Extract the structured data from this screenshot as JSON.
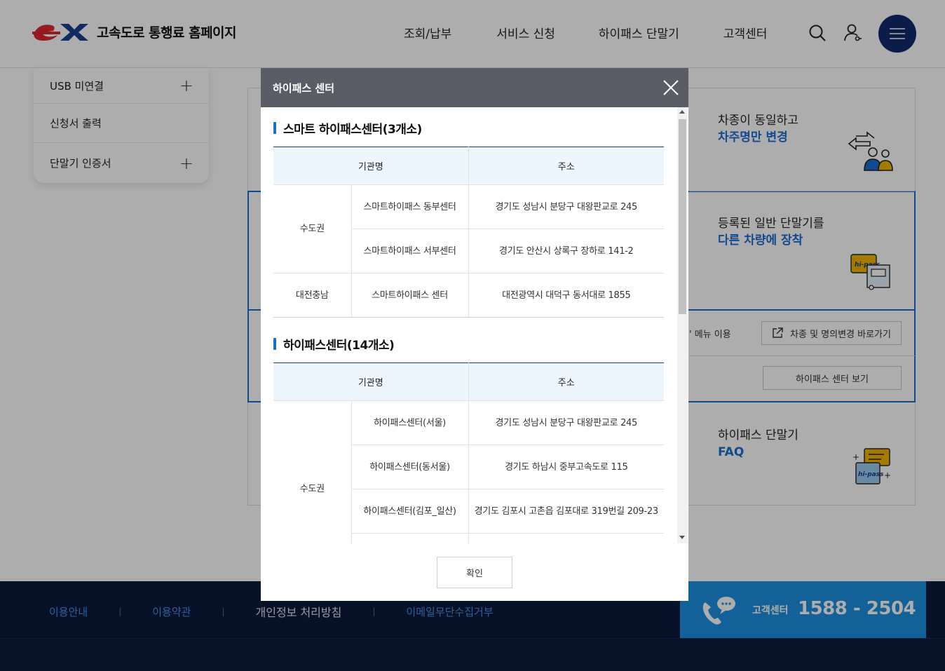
{
  "header": {
    "site_title": "고속도로 통행료 홈페이지",
    "nav": [
      "조회/납부",
      "서비스 신청",
      "하이패스 단말기",
      "고객센터"
    ]
  },
  "lnb": {
    "items": [
      {
        "label": "USB 미연결",
        "expandable": true
      },
      {
        "label": "신청서 출력",
        "expandable": false
      },
      {
        "label": "단말기 인증서",
        "expandable": true
      }
    ]
  },
  "cards": {
    "card1_line1": "차종이 동일하고",
    "card1_line2": "차주명만 변경",
    "card2_line1": "등록된 일반 단말기를",
    "card2_line2": "다른 차량에 장착",
    "menu_use": "' 메뉴 이용",
    "change_link": "차종 및 명의변경 바로가기",
    "center_link": "하이패스 센터 보기",
    "card3_line1": "하이패스 단말기",
    "card3_line2": "FAQ",
    "hipass_badge": "hi-pass"
  },
  "footer": {
    "links": [
      "이용안내",
      "이용약관",
      "개인정보 처리방침",
      "이메일무단수집거부"
    ],
    "separator": "|",
    "cs_label": "고객센터",
    "cs_number": "1588 - 2504"
  },
  "modal": {
    "title": "하이패스 센터",
    "confirm": "확인",
    "col_org": "기관명",
    "col_addr": "주소",
    "smart": {
      "title": "스마트 하이패스센터(3개소)",
      "rows": [
        {
          "region": "수도권",
          "name": "스마트하이패스 동부센터",
          "addr": "경기도 성남시 분당구 대왕판교로 245"
        },
        {
          "region": "",
          "name": "스마트하이패스 서부센터",
          "addr": "경기도 안산시 상록구 장하로 141-2"
        },
        {
          "region": "대전충남",
          "name": "스마트하이패스 센터",
          "addr": "대전광역시 대덕구 동서대로 1855"
        }
      ]
    },
    "hipass": {
      "title": "하이패스센터(14개소)",
      "rows": [
        {
          "region": "수도권",
          "name": "하이패스센터(서울)",
          "addr": "경기도 성남시 분당구 대왕판교로 245"
        },
        {
          "region": "",
          "name": "하이패스센터(동서울)",
          "addr": "경기도 하남시 중부고속도로 115"
        },
        {
          "region": "",
          "name": "하이패스센터(김포_일산)",
          "addr": "경기도 김포시 고촌읍 김포대로 319번길 209-23"
        }
      ]
    }
  },
  "colors": {
    "brand_red": "#e0262d",
    "brand_navy": "#0e2c6b",
    "accent_blue": "#1a6fd1",
    "modal_header": "#5a5d66"
  }
}
